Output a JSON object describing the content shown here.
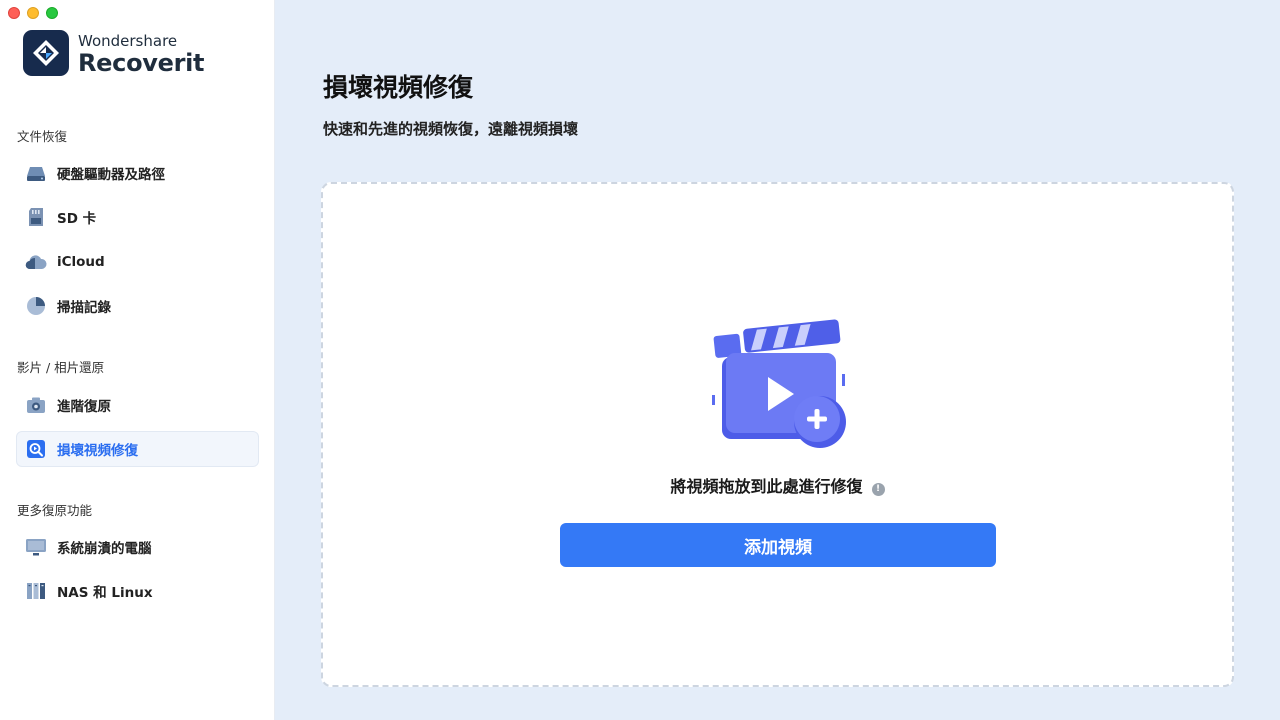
{
  "app": {
    "brand": "Wondershare",
    "product": "Recoverit"
  },
  "sidebar": {
    "sections": [
      {
        "label": "文件恢復",
        "items": [
          {
            "label": "硬盤驅動器及路徑",
            "icon": "hard-drive-icon"
          },
          {
            "label": "SD 卡",
            "icon": "sd-card-icon"
          },
          {
            "label": "iCloud",
            "icon": "cloud-icon"
          },
          {
            "label": "掃描記錄",
            "icon": "pie-chart-icon"
          }
        ]
      },
      {
        "label": "影片 / 相片還原",
        "items": [
          {
            "label": "進階復原",
            "icon": "camera-icon"
          },
          {
            "label": "損壞視頻修復",
            "icon": "video-repair-icon",
            "active": true
          }
        ]
      },
      {
        "label": "更多復原功能",
        "items": [
          {
            "label": "系統崩潰的電腦",
            "icon": "monitor-icon"
          },
          {
            "label": "NAS 和 Linux",
            "icon": "nas-icon"
          }
        ]
      }
    ]
  },
  "main": {
    "title": "損壞視頻修復",
    "subtitle": "快速和先進的視頻恢復，遠離視頻損壞",
    "dropzone": {
      "text": "將視頻拖放到此處進行修復",
      "info_icon": "info-icon",
      "button_label": "添加視頻"
    }
  },
  "colors": {
    "accent": "#3479f6",
    "active_text": "#2b6ef0",
    "background": "#e4edf9",
    "logo_bg": "#172b4d"
  }
}
